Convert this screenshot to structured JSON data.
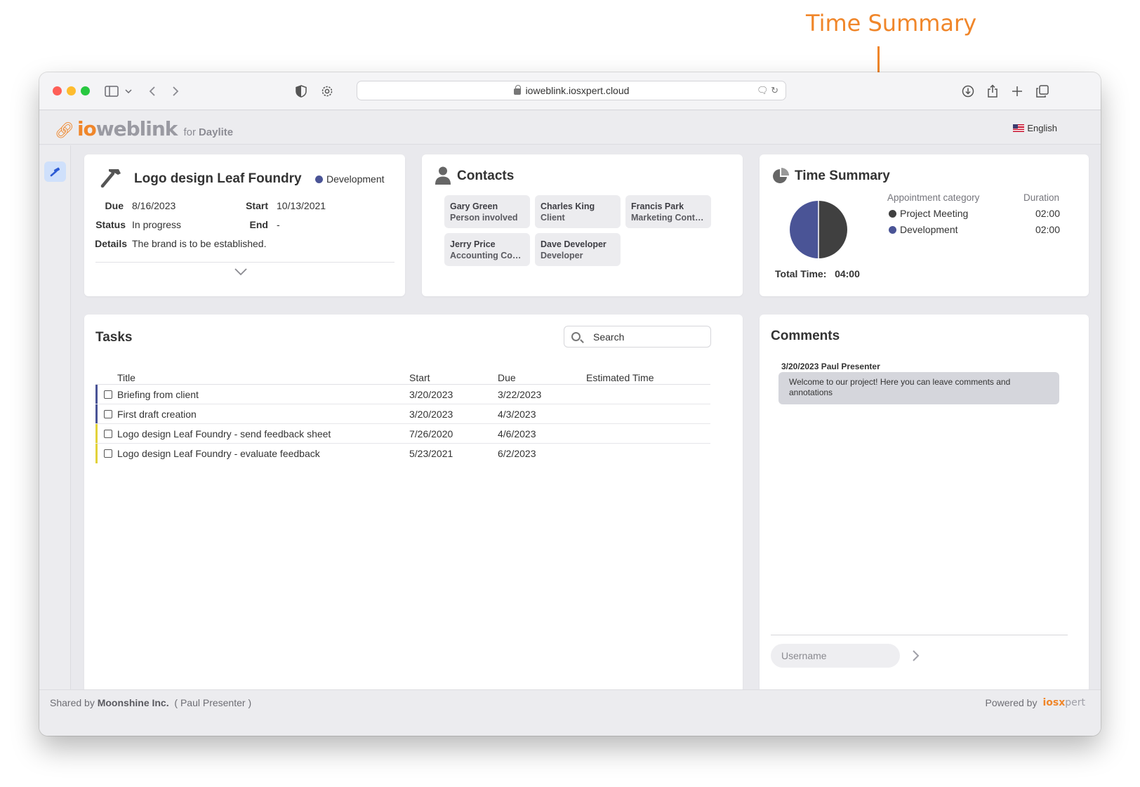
{
  "annotation": {
    "label": "Time Summary"
  },
  "browser": {
    "url": "ioweblink.iosxpert.cloud",
    "icons": [
      "sidebar-icon",
      "chevron-down-icon",
      "back-icon",
      "forward-icon",
      "shield-icon",
      "gear-icon",
      "translate-icon",
      "reload-icon",
      "download-icon",
      "share-icon",
      "new-tab-icon",
      "tabs-overview-icon"
    ]
  },
  "header": {
    "logo_io": "io",
    "logo_weblink": "weblink",
    "logo_for": "for",
    "logo_daylite": "Daylite",
    "language": "English"
  },
  "project": {
    "title": "Logo design Leaf Foundry",
    "category": "Development",
    "category_color": "#4a5496",
    "due_label": "Due",
    "due": "8/16/2023",
    "start_label": "Start",
    "start": "10/13/2021",
    "status_label": "Status",
    "status": "In progress",
    "end_label": "End",
    "end": "-",
    "details_label": "Details",
    "details": "The brand is to be established."
  },
  "contacts": {
    "title": "Contacts",
    "items": [
      {
        "name": "Gary Green",
        "role": "Person involved"
      },
      {
        "name": "Charles King",
        "role": "Client"
      },
      {
        "name": "Francis Park",
        "role": "Marketing Contact"
      },
      {
        "name": "Jerry Price",
        "role": "Accounting Con..."
      },
      {
        "name": "Dave Developer",
        "role": "Developer"
      }
    ]
  },
  "time_summary": {
    "title": "Time Summary",
    "col_category": "Appointment category",
    "col_duration": "Duration",
    "rows": [
      {
        "category": "Project Meeting",
        "duration": "02:00",
        "color": "#404040"
      },
      {
        "category": "Development",
        "duration": "02:00",
        "color": "#4a5496"
      }
    ],
    "total_label": "Total Time:",
    "total_value": "04:00"
  },
  "tasks": {
    "title": "Tasks",
    "search_placeholder": "Search",
    "columns": {
      "title": "Title",
      "start": "Start",
      "due": "Due",
      "estimated": "Estimated Time"
    },
    "rows": [
      {
        "title": "Briefing from client",
        "start": "3/20/2023",
        "due": "3/22/2023",
        "estimated": "",
        "color": "#4a5496"
      },
      {
        "title": "First draft creation",
        "start": "3/20/2023",
        "due": "4/3/2023",
        "estimated": "",
        "color": "#4a5496"
      },
      {
        "title": "Logo design Leaf Foundry - send feedback sheet",
        "start": "7/26/2020",
        "due": "4/6/2023",
        "estimated": "",
        "color": "#e2d23a"
      },
      {
        "title": "Logo design Leaf Foundry - evaluate feedback",
        "start": "5/23/2021",
        "due": "6/2/2023",
        "estimated": "",
        "color": "#e2d23a"
      }
    ]
  },
  "comments": {
    "title": "Comments",
    "items": [
      {
        "header": "3/20/2023 Paul Presenter",
        "text": "Welcome to our project! Here you can leave comments and annotations"
      }
    ],
    "username_placeholder": "Username"
  },
  "footer": {
    "shared_prefix": "Shared by",
    "company": "Moonshine Inc.",
    "user": "( Paul Presenter )",
    "powered_by": "Powered by",
    "brand_main": "iosx",
    "brand_rest": "pert"
  }
}
